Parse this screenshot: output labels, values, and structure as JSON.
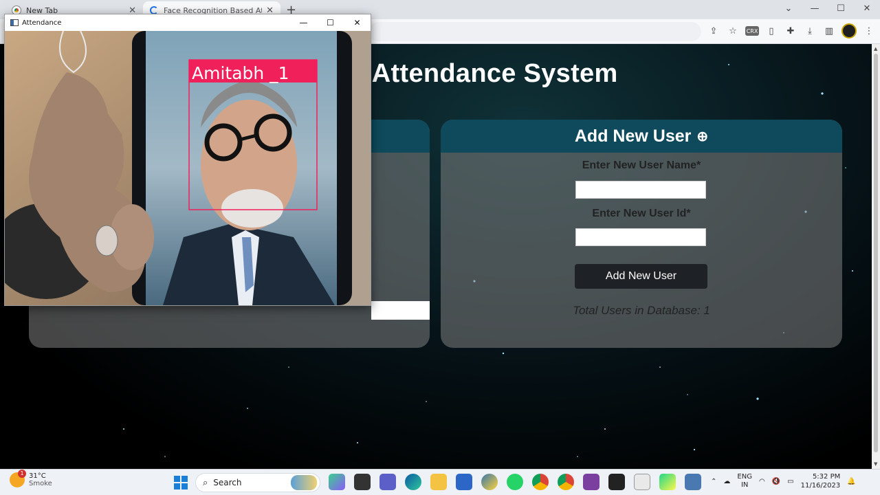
{
  "browser": {
    "tabs": [
      {
        "title": "New Tab",
        "active": false
      },
      {
        "title": "Face Recognition Based Attenda",
        "active": true
      }
    ],
    "new_tab_symbol": "+",
    "window_controls": [
      "—",
      "☐",
      "✕"
    ],
    "toolbar_icons": [
      "share-icon",
      "star-icon",
      "crx-icon",
      "extension-icon",
      "puzzle-icon",
      "download-icon",
      "sidepanel-icon",
      "avatar",
      "menu-icon"
    ],
    "crx_label": "CRX"
  },
  "page": {
    "title_visible": "n Based Attendance System",
    "left_panel": {},
    "right_panel": {
      "header": "Add New User",
      "header_icon": "⊕",
      "name_label": "Enter New User Name*",
      "name_value": "",
      "id_label": "Enter New User Id*",
      "id_value": "",
      "button": "Add New User",
      "total_users": "Total Users in Database: 1"
    }
  },
  "attendance_window": {
    "title": "Attendance",
    "controls": [
      "—",
      "☐",
      "✕"
    ],
    "detection_label": "Amitabh _1",
    "box_color": "#f0205a"
  },
  "taskbar": {
    "weather_temp": "31°C",
    "weather_desc": "Smoke",
    "weather_badge": "1",
    "search_placeholder": "Search",
    "language": "ENG",
    "region": "IN",
    "time": "5:32 PM",
    "date": "11/16/2023"
  }
}
